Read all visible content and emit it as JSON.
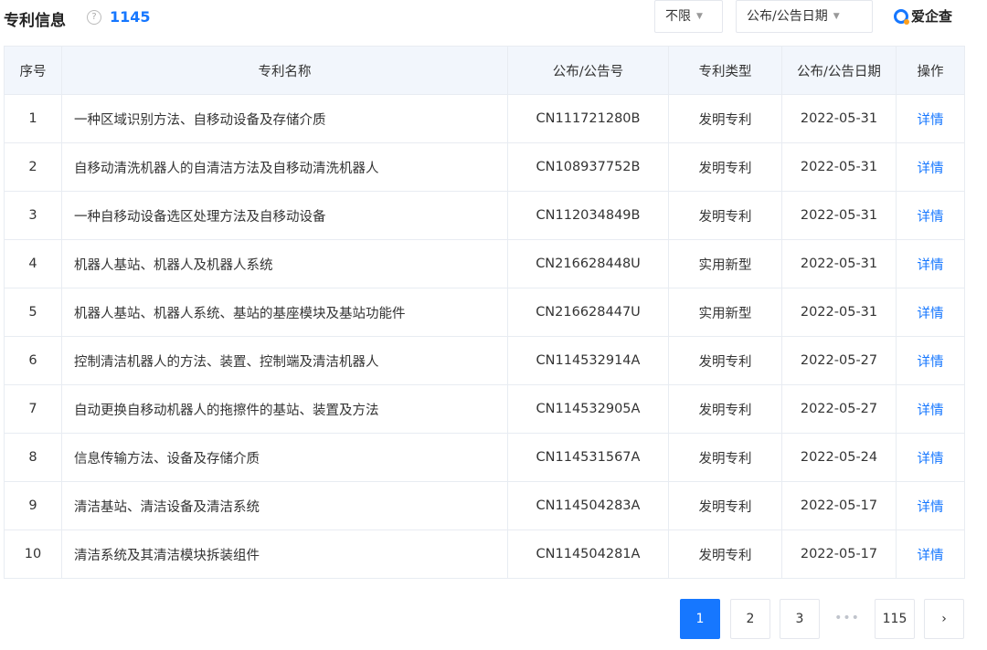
{
  "header": {
    "title": "专利信息",
    "help_icon": "?",
    "count": "1145",
    "filter_type": "不限",
    "filter_date": "公布/公告日期",
    "logo_text": "爱企查",
    "caret": "▼"
  },
  "table": {
    "columns": [
      "序号",
      "专利名称",
      "公布/公告号",
      "专利类型",
      "公布/公告日期",
      "操作"
    ],
    "rows": [
      {
        "no": "1",
        "name": "一种区域识别方法、自移动设备及存储介质",
        "pub_no": "CN111721280B",
        "type": "发明专利",
        "date": "2022-05-31",
        "action": "详情"
      },
      {
        "no": "2",
        "name": "自移动清洗机器人的自清洁方法及自移动清洗机器人",
        "pub_no": "CN108937752B",
        "type": "发明专利",
        "date": "2022-05-31",
        "action": "详情"
      },
      {
        "no": "3",
        "name": "一种自移动设备选区处理方法及自移动设备",
        "pub_no": "CN112034849B",
        "type": "发明专利",
        "date": "2022-05-31",
        "action": "详情"
      },
      {
        "no": "4",
        "name": "机器人基站、机器人及机器人系统",
        "pub_no": "CN216628448U",
        "type": "实用新型",
        "date": "2022-05-31",
        "action": "详情"
      },
      {
        "no": "5",
        "name": "机器人基站、机器人系统、基站的基座模块及基站功能件",
        "pub_no": "CN216628447U",
        "type": "实用新型",
        "date": "2022-05-31",
        "action": "详情"
      },
      {
        "no": "6",
        "name": "控制清洁机器人的方法、装置、控制端及清洁机器人",
        "pub_no": "CN114532914A",
        "type": "发明专利",
        "date": "2022-05-27",
        "action": "详情"
      },
      {
        "no": "7",
        "name": "自动更换自移动机器人的拖擦件的基站、装置及方法",
        "pub_no": "CN114532905A",
        "type": "发明专利",
        "date": "2022-05-27",
        "action": "详情"
      },
      {
        "no": "8",
        "name": "信息传输方法、设备及存储介质",
        "pub_no": "CN114531567A",
        "type": "发明专利",
        "date": "2022-05-24",
        "action": "详情"
      },
      {
        "no": "9",
        "name": "清洁基站、清洁设备及清洁系统",
        "pub_no": "CN114504283A",
        "type": "发明专利",
        "date": "2022-05-17",
        "action": "详情"
      },
      {
        "no": "10",
        "name": "清洁系统及其清洁模块拆装组件",
        "pub_no": "CN114504281A",
        "type": "发明专利",
        "date": "2022-05-17",
        "action": "详情"
      }
    ]
  },
  "pagination": {
    "pages": [
      "1",
      "2",
      "3"
    ],
    "current": "1",
    "ellipsis": "•••",
    "last": "115",
    "next": "›"
  },
  "colors": {
    "accent": "#1677ff",
    "header_bg": "#f2f6fc",
    "border": "#e8ecf2"
  },
  "icons": {
    "help": "question-circle-icon",
    "logo": "search-magnifier-logo-icon",
    "caret": "caret-down-icon",
    "next": "chevron-right-icon"
  }
}
